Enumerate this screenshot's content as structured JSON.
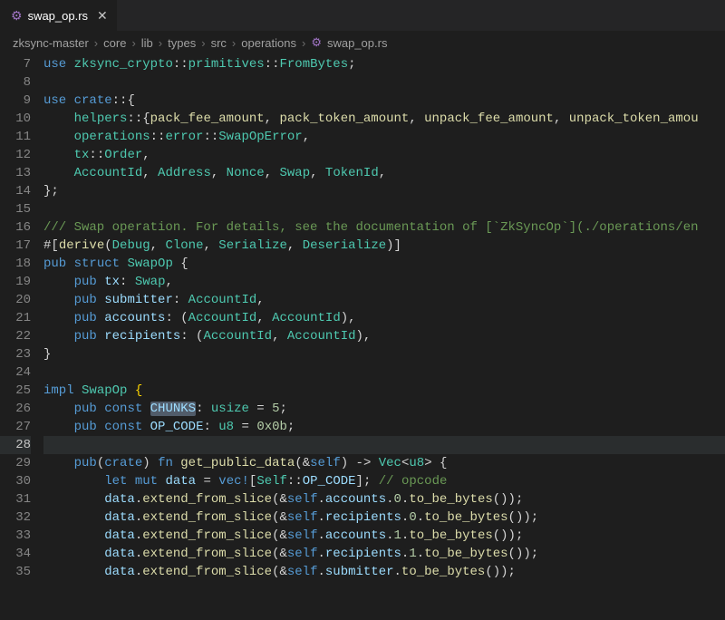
{
  "tab": {
    "icon": "⚙",
    "label": "swap_op.rs",
    "close": "✕"
  },
  "breadcrumb": {
    "items": [
      "zksync-master",
      "core",
      "lib",
      "types",
      "src",
      "operations",
      "swap_op.rs"
    ],
    "sep": "›",
    "file_icon": "⚙"
  },
  "first_line_number": 7,
  "highlighted_line": 28,
  "code_lines": [
    {
      "n": 7,
      "html": "<span class='kw'>use</span> <span class='ns'>zksync_crypto</span>::<span class='ns'>primitives</span>::<span class='ty'>FromBytes</span>;"
    },
    {
      "n": 8,
      "html": ""
    },
    {
      "n": 9,
      "html": "<span class='kw'>use</span> <span class='kw'>crate</span>::{"
    },
    {
      "n": 10,
      "html": "    <span class='ns'>helpers</span>::{<span class='fn'>pack_fee_amount</span>, <span class='fn'>pack_token_amount</span>, <span class='fn'>unpack_fee_amount</span>, <span class='fn'>unpack_token_amou</span>"
    },
    {
      "n": 11,
      "html": "    <span class='ns'>operations</span>::<span class='ns'>error</span>::<span class='ty'>SwapOpError</span>,"
    },
    {
      "n": 12,
      "html": "    <span class='ns'>tx</span>::<span class='ty'>Order</span>,"
    },
    {
      "n": 13,
      "html": "    <span class='ty'>AccountId</span>, <span class='ty'>Address</span>, <span class='ty'>Nonce</span>, <span class='ty'>Swap</span>, <span class='ty'>TokenId</span>,"
    },
    {
      "n": 14,
      "html": "};"
    },
    {
      "n": 15,
      "html": ""
    },
    {
      "n": 16,
      "html": "<span class='cmt'>/// Swap operation. For details, see the documentation of [`ZkSyncOp`](./operations/en</span>"
    },
    {
      "n": 17,
      "html": "#[<span class='fn'>derive</span>(<span class='ty'>Debug</span>, <span class='ty'>Clone</span>, <span class='ty'>Serialize</span>, <span class='ty'>Deserialize</span>)]"
    },
    {
      "n": 18,
      "html": "<span class='kw'>pub</span> <span class='kw'>struct</span> <span class='ty'>SwapOp</span> {"
    },
    {
      "n": 19,
      "html": "    <span class='kw'>pub</span> <span class='fld'>tx</span>: <span class='ty'>Swap</span>,"
    },
    {
      "n": 20,
      "html": "    <span class='kw'>pub</span> <span class='fld'>submitter</span>: <span class='ty'>AccountId</span>,"
    },
    {
      "n": 21,
      "html": "    <span class='kw'>pub</span> <span class='fld'>accounts</span>: (<span class='ty'>AccountId</span>, <span class='ty'>AccountId</span>),"
    },
    {
      "n": 22,
      "html": "    <span class='kw'>pub</span> <span class='fld'>recipients</span>: (<span class='ty'>AccountId</span>, <span class='ty'>AccountId</span>),"
    },
    {
      "n": 23,
      "html": "}"
    },
    {
      "n": 24,
      "html": ""
    },
    {
      "n": 25,
      "html": "<span class='kw'>impl</span> <span class='ty'>SwapOp</span> <span class='brace'>{</span>"
    },
    {
      "n": 26,
      "html": "    <span class='kw'>pub</span> <span class='kw'>const</span> <span class='sel'><span class='fld'>CHUNKS</span></span>: <span class='ty'>usize</span> = <span class='num'>5</span>;"
    },
    {
      "n": 27,
      "html": "    <span class='kw'>pub</span> <span class='kw'>const</span> <span class='fld'>OP_CODE</span>: <span class='ty'>u8</span> = <span class='num'>0x0b</span>;"
    },
    {
      "n": 28,
      "html": ""
    },
    {
      "n": 29,
      "html": "    <span class='kw'>pub</span>(<span class='kw'>crate</span>) <span class='kw'>fn</span> <span class='fn'>get_public_data</span>(&<span class='kw'>self</span>) -> <span class='ty'>Vec</span>&lt;<span class='ty'>u8</span>&gt; {"
    },
    {
      "n": 30,
      "html": "        <span class='kw'>let</span> <span class='kw'>mut</span> <span class='fld'>data</span> = <span class='mac'>vec!</span>[<span class='ty'>Self</span>::<span class='fld'>OP_CODE</span>]; <span class='cmt'>// opcode</span>"
    },
    {
      "n": 31,
      "html": "        <span class='fld'>data</span>.<span class='fn'>extend_from_slice</span>(&<span class='kw'>self</span>.<span class='fld'>accounts</span>.<span class='num'>0</span>.<span class='fn'>to_be_bytes</span>());"
    },
    {
      "n": 32,
      "html": "        <span class='fld'>data</span>.<span class='fn'>extend_from_slice</span>(&<span class='kw'>self</span>.<span class='fld'>recipients</span>.<span class='num'>0</span>.<span class='fn'>to_be_bytes</span>());"
    },
    {
      "n": 33,
      "html": "        <span class='fld'>data</span>.<span class='fn'>extend_from_slice</span>(&<span class='kw'>self</span>.<span class='fld'>accounts</span>.<span class='num'>1</span>.<span class='fn'>to_be_bytes</span>());"
    },
    {
      "n": 34,
      "html": "        <span class='fld'>data</span>.<span class='fn'>extend_from_slice</span>(&<span class='kw'>self</span>.<span class='fld'>recipients</span>.<span class='num'>1</span>.<span class='fn'>to_be_bytes</span>());"
    },
    {
      "n": 35,
      "html": "        <span class='fld'>data</span>.<span class='fn'>extend_from_slice</span>(&<span class='kw'>self</span>.<span class='fld'>submitter</span>.<span class='fn'>to_be_bytes</span>());"
    }
  ]
}
